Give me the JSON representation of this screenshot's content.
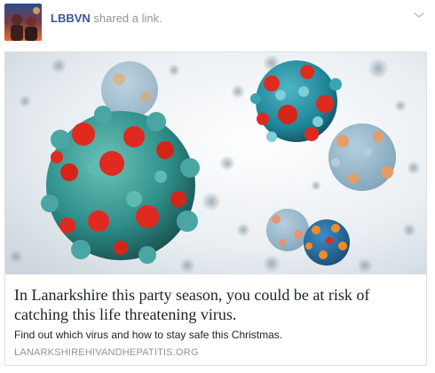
{
  "post": {
    "actor_name": "LBBVN",
    "action_text": "shared a link."
  },
  "link_card": {
    "title": "In Lanarkshire this party season, you could be at risk of catching this life threatening virus.",
    "description": "Find out which virus and how to stay safe this Christmas.",
    "domain": "LANARKSHIREHIVANDHEPATITIS.ORG"
  },
  "colors": {
    "actor_link": "#365899",
    "meta_text": "#90949c",
    "card_border": "#dddfe2",
    "virus_body": "#2f8f8a",
    "virus_spikes": "#e02a1f",
    "image_background": "#e8eef2"
  },
  "icons": {
    "menu": "chevron-down-icon",
    "avatar": "profile-avatar"
  }
}
